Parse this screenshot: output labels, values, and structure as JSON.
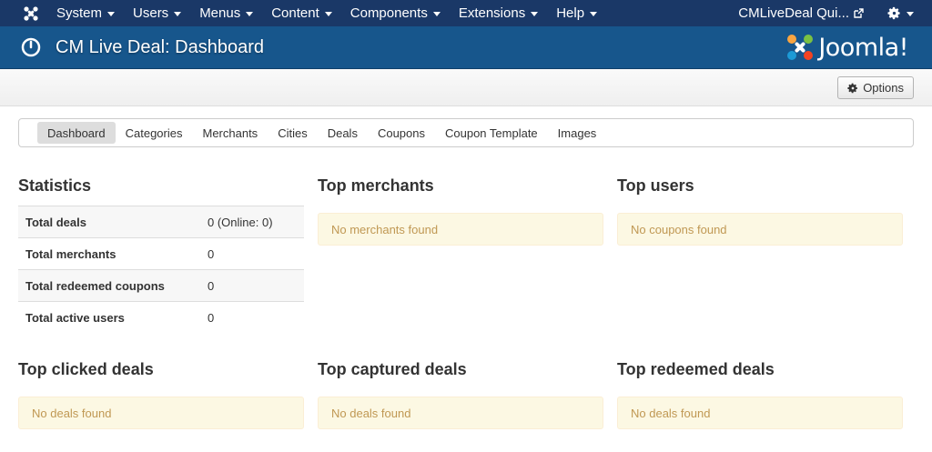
{
  "topnav": {
    "menu": [
      "System",
      "Users",
      "Menus",
      "Content",
      "Components",
      "Extensions",
      "Help"
    ],
    "site_link": "CMLiveDeal Qui..."
  },
  "header": {
    "title": "CM Live Deal: Dashboard",
    "logo_text": "Joomla!"
  },
  "toolbar": {
    "options_label": "Options"
  },
  "subnav": {
    "items": [
      "Dashboard",
      "Categories",
      "Merchants",
      "Cities",
      "Deals",
      "Coupons",
      "Coupon Template",
      "Images"
    ],
    "active": "Dashboard"
  },
  "statistics": {
    "title": "Statistics",
    "rows": [
      {
        "label": "Total deals",
        "value": "0 (Online: 0)"
      },
      {
        "label": "Total merchants",
        "value": "0"
      },
      {
        "label": "Total redeemed coupons",
        "value": "0"
      },
      {
        "label": "Total active users",
        "value": "0"
      }
    ]
  },
  "top_merchants": {
    "title": "Top merchants",
    "empty": "No merchants found"
  },
  "top_users": {
    "title": "Top users",
    "empty": "No coupons found"
  },
  "top_clicked": {
    "title": "Top clicked deals",
    "empty": "No deals found"
  },
  "top_captured": {
    "title": "Top captured deals",
    "empty": "No deals found"
  },
  "top_redeemed": {
    "title": "Top redeemed deals",
    "empty": "No deals found"
  },
  "colors": {
    "nav_bg": "#1a3867",
    "header_bg": "#17568c",
    "notice_bg": "#fcf8e3",
    "notice_text": "#c09853"
  }
}
